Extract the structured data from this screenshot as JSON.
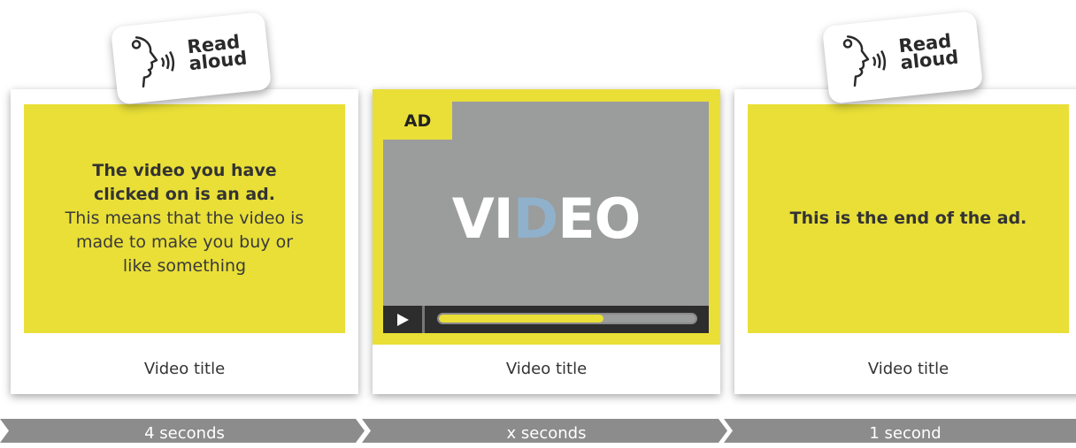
{
  "cards": [
    {
      "message_bold": [
        "The video you have",
        "clicked on is an ad."
      ],
      "message_normal": [
        "This means that the video is",
        "made to make you buy or",
        "like something"
      ],
      "caption": "Video title"
    },
    {
      "ad_label": "AD",
      "video_text_pre": "VI",
      "video_text_hl": "D",
      "video_text_post": "EO",
      "progress_fraction": 0.64,
      "caption": "Video title"
    },
    {
      "message_bold": [
        "This is the end of the ad."
      ],
      "caption": "Video title"
    }
  ],
  "badges": [
    {
      "line1": "Read",
      "line2": "aloud",
      "icon": "speaking-head-icon"
    },
    {
      "line1": "Read",
      "line2": "aloud",
      "icon": "speaking-head-icon"
    }
  ],
  "timeline": [
    "4 seconds",
    "x seconds",
    "1 second"
  ],
  "colors": {
    "accent_yellow": "#e9df37",
    "video_gray": "#9b9c9c",
    "timeline_gray": "#8c8c8c",
    "highlight_blue": "#8fb1cc"
  }
}
